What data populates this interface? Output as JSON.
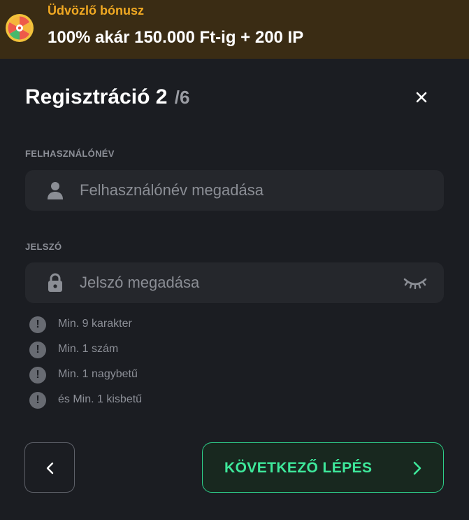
{
  "banner": {
    "subtitle": "Üdvözlő bónusz",
    "title": "100% akár 150.000 Ft-ig + 200 IP",
    "accent_color": "#f0a822",
    "icon": "prize-wheel-icon"
  },
  "form": {
    "title": "Regisztráció 2",
    "steps": "/6",
    "username": {
      "label": "FELHASZNÁLÓNÉV",
      "placeholder": "Felhasználónév megadása",
      "value": "",
      "icon": "user-icon"
    },
    "password": {
      "label": "JELSZÓ",
      "placeholder": "Jelszó megadása",
      "value": "",
      "icon": "lock-icon",
      "toggle_icon": "eye-closed-icon"
    },
    "requirements": [
      "Min. 9 karakter",
      "Min. 1 szám",
      "Min. 1 nagybetű",
      "és Min. 1 kisbetű"
    ],
    "requirement_icon": "exclamation-icon"
  },
  "actions": {
    "back_icon": "chevron-left-icon",
    "next_label": "KÖVETKEZŐ LÉPÉS",
    "next_icon": "chevron-right-icon",
    "next_color": "#3ee89b",
    "close_icon": "close-icon"
  }
}
